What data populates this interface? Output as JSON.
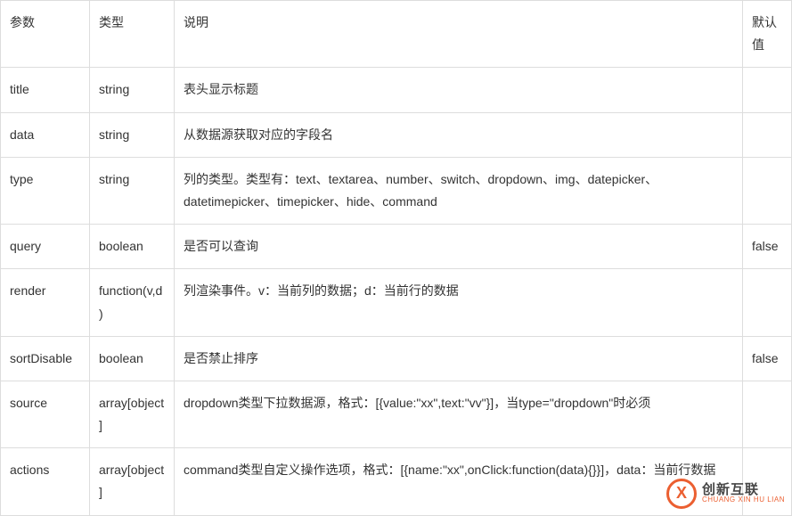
{
  "table": {
    "headers": {
      "param": "参数",
      "type": "类型",
      "desc": "说明",
      "default": "默认值"
    },
    "rows": [
      {
        "param": "title",
        "type": "string",
        "desc": "表头显示标题",
        "default": ""
      },
      {
        "param": "data",
        "type": "string",
        "desc": "从数据源获取对应的字段名",
        "default": ""
      },
      {
        "param": "type",
        "type": "string",
        "desc": "列的类型。类型有：text、textarea、number、switch、dropdown、img、datepicker、datetimepicker、timepicker、hide、command",
        "default": ""
      },
      {
        "param": "query",
        "type": "boolean",
        "desc": "是否可以查询",
        "default": "false"
      },
      {
        "param": "render",
        "type": "function(v,d)",
        "desc": "列渲染事件。v：当前列的数据；d：当前行的数据",
        "default": ""
      },
      {
        "param": "sortDisable",
        "type": "boolean",
        "desc": "是否禁止排序",
        "default": "false"
      },
      {
        "param": "source",
        "type": "array[object]",
        "desc": "dropdown类型下拉数据源，格式：[{value:\"xx\",text:\"vv\"}]，当type=\"dropdown\"时必须",
        "default": ""
      },
      {
        "param": "actions",
        "type": "array[object]",
        "desc": "command类型自定义操作选项，格式：[{name:\"xx\",onClick:function(data){}}]，data：当前行数据",
        "default": ""
      }
    ]
  },
  "watermark": {
    "logo_letter": "X",
    "cn": "创新互联",
    "en": "CHUANG XIN HU LIAN"
  }
}
